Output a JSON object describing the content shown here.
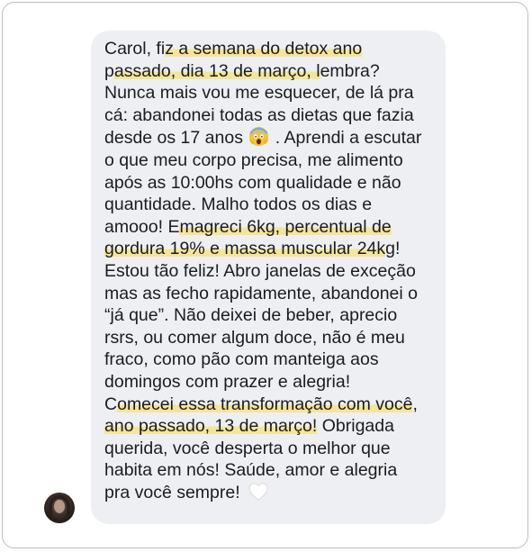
{
  "chat": {
    "message": {
      "lines": [
        {
          "segments": [
            {
              "text": "Carol, fi",
              "hl": false
            },
            {
              "text": "z a semana do detox ano",
              "hl": true
            }
          ]
        },
        {
          "segments": [
            {
              "text": "p",
              "hl": false
            },
            {
              "text": "assado, dia 13 de março, l",
              "hl": true
            },
            {
              "text": "embra?",
              "hl": false
            }
          ]
        },
        {
          "segments": [
            {
              "text": "Nunca mais vou me esquecer, de lá pra",
              "hl": false
            }
          ]
        },
        {
          "segments": [
            {
              "text": "cá: abandonei todas as dietas que fazia",
              "hl": false
            }
          ]
        },
        {
          "segments": [
            {
              "text": "desde os 17 anos ",
              "hl": false
            },
            {
              "emoji": "screaming-face-emoji"
            },
            {
              "text": " . Aprendi a escutar",
              "hl": false
            }
          ]
        },
        {
          "segments": [
            {
              "text": "o que meu corpo precisa, me alimento",
              "hl": false
            }
          ]
        },
        {
          "segments": [
            {
              "text": "após as 10:00hs com qualidade e não",
              "hl": false
            }
          ]
        },
        {
          "segments": [
            {
              "text": "quantidade. Malho todos os dias e",
              "hl": false
            }
          ]
        },
        {
          "segments": [
            {
              "text": "amooo! E",
              "hl": false
            },
            {
              "text": "magreci 6kg, percentual de",
              "hl": true
            }
          ]
        },
        {
          "segments": [
            {
              "text": "gordura 19% e massa muscular 24k",
              "hl": true
            },
            {
              "text": "g!",
              "hl": false
            }
          ]
        },
        {
          "segments": [
            {
              "text": "Estou tão feliz! Abro janelas de exceção",
              "hl": false
            }
          ]
        },
        {
          "segments": [
            {
              "text": "mas as fecho rapidamente, abandonei o",
              "hl": false
            }
          ]
        },
        {
          "segments": [
            {
              "text": "“já que”. Não deixei de beber, aprecio",
              "hl": false
            }
          ]
        },
        {
          "segments": [
            {
              "text": "rsrs, ou comer algum doce, não é meu",
              "hl": false
            }
          ]
        },
        {
          "segments": [
            {
              "text": "fraco, como pão com manteiga aos",
              "hl": false
            }
          ]
        },
        {
          "segments": [
            {
              "text": "domingos com prazer e alegria!",
              "hl": false
            }
          ]
        },
        {
          "segments": [
            {
              "text": "C",
              "hl": false
            },
            {
              "text": "omecei essa transformação com você",
              "hl": true
            },
            {
              "text": ",",
              "hl": false
            }
          ]
        },
        {
          "segments": [
            {
              "text": "ano passado, 13 de março!",
              "hl": true
            },
            {
              "text": " Obrigada",
              "hl": false
            }
          ]
        },
        {
          "segments": [
            {
              "text": "querida, você desperta o melhor que",
              "hl": false
            }
          ]
        },
        {
          "segments": [
            {
              "text": "habita em nós! Saúde, amor e alegria",
              "hl": false
            }
          ]
        },
        {
          "segments": [
            {
              "text": "pra você sempre! ",
              "hl": false
            },
            {
              "emoji": "white-heart-emoji"
            }
          ]
        }
      ]
    },
    "sender": {
      "avatar_icon": "profile-photo"
    },
    "colors": {
      "bubble": "#eeeff2",
      "highlight": "#f4e59a",
      "text": "#1c1c1e",
      "frame_border": "#bdbdbd"
    }
  }
}
